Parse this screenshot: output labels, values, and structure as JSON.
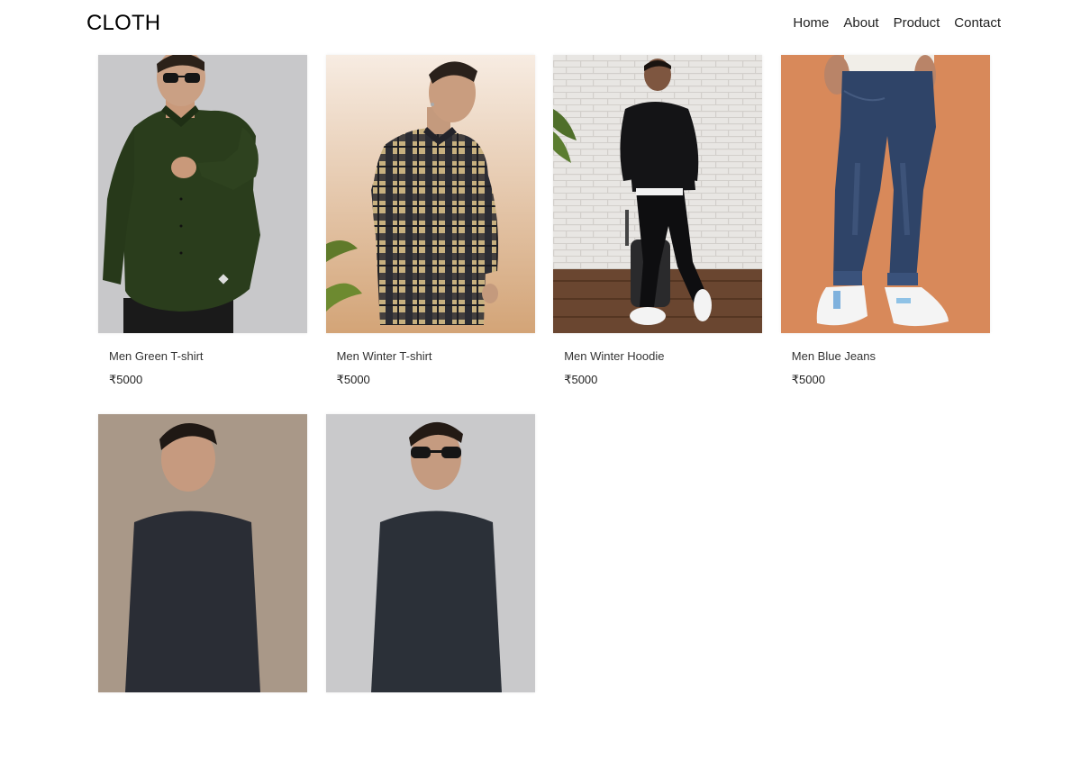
{
  "navbar": {
    "brand": "CLOTH",
    "links": [
      {
        "label": "Home"
      },
      {
        "label": "About"
      },
      {
        "label": "Product"
      },
      {
        "label": "Contact"
      }
    ]
  },
  "products": [
    {
      "title": "Men Green T-shirt",
      "price": "₹5000"
    },
    {
      "title": "Men Winter T-shirt",
      "price": "₹5000"
    },
    {
      "title": "Men Winter Hoodie",
      "price": "₹5000"
    },
    {
      "title": "Men Blue Jeans",
      "price": "₹5000"
    },
    {
      "title": "",
      "price": ""
    },
    {
      "title": "",
      "price": ""
    }
  ],
  "colors": {
    "background": "#ffffff",
    "text": "#222222",
    "product_backgrounds": [
      "#c8c8ca",
      "#f1e3d2",
      "#e4e2e0",
      "#d8895a",
      "#a99888",
      "#c9c9cb"
    ]
  }
}
